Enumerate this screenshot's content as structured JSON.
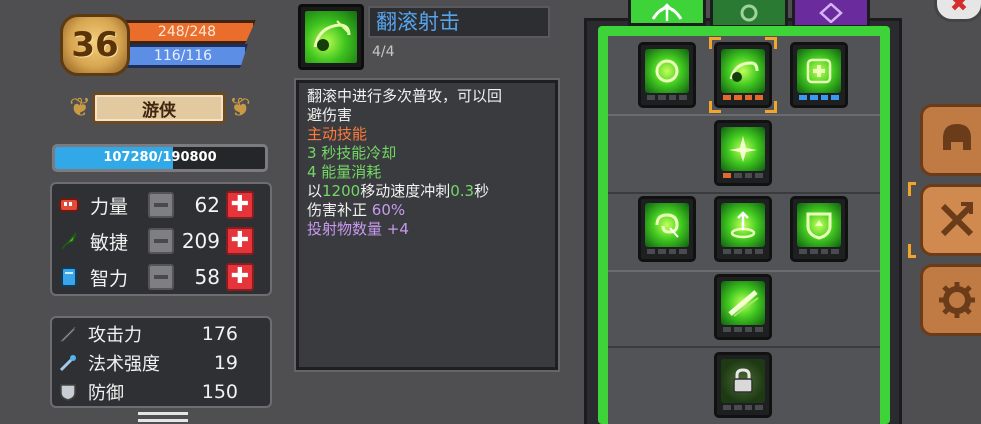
{
  "player": {
    "level": "36",
    "hp": "248/248",
    "mp": "116/116",
    "class_name": "游侠",
    "xp_text": "107280/190800",
    "xp_fraction": 0.562
  },
  "attributes": [
    {
      "name": "力量",
      "value": "62",
      "icon": "fist-icon"
    },
    {
      "name": "敏捷",
      "value": "209",
      "icon": "feather-icon"
    },
    {
      "name": "智力",
      "value": "58",
      "icon": "book-icon"
    }
  ],
  "stats": [
    {
      "name": "攻击力",
      "value": "176",
      "icon": "sword-icon"
    },
    {
      "name": "法术强度",
      "value": "19",
      "icon": "wand-icon"
    },
    {
      "name": "防御",
      "value": "150",
      "icon": "shield-icon"
    }
  ],
  "tooltip": {
    "title": "翻滚射击",
    "count": "4/4",
    "desc_1": "翻滚中进行多次普攻，可以回",
    "desc_2": "避伤害",
    "type": "主动技能",
    "cooldown": "3 秒技能冷却",
    "energy": "4 能量消耗",
    "dash_pre": "以",
    "dash_speed": "1200",
    "dash_mid": "移动速度冲刺",
    "dash_time": "0.3",
    "dash_post": "秒",
    "damage_label": "伤害补正",
    "damage_value": "60%",
    "projectiles": "投射物数量 +4"
  },
  "colors": {
    "accent_green": "#3fd33a",
    "hp": "#ea6d2b",
    "mp": "#5d8ee6",
    "xp": "#31a9e8",
    "title_blue": "#56a4ee",
    "plus_red": "#e6353a"
  },
  "tree_tabs": [
    "bow-icon",
    "swirl-icon",
    "rune-icon"
  ],
  "side_buttons": [
    "helmet-icon",
    "skills-icon",
    "gear-icon"
  ]
}
